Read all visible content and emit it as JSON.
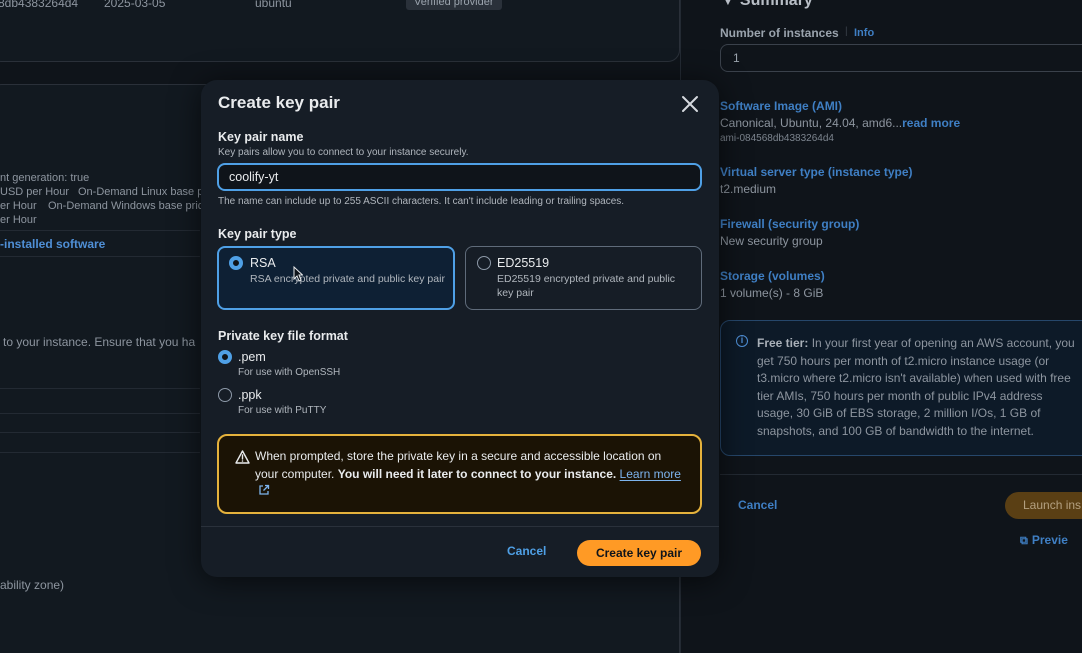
{
  "background": {
    "top_row": {
      "id": "8db4383264d4",
      "date": "2025-03-05",
      "platform": "ubuntu",
      "badge": "Verified provider"
    },
    "left_lines": [
      "nt generation: true",
      "USD per Hour",
      "On-Demand Linux base pric",
      "er Hour",
      "On-Demand Windows base pric",
      "er Hour"
    ],
    "preinstalled_link": "-installed software",
    "keypair_hint": "to your instance. Ensure that you ha",
    "availability_zone": "ability zone)",
    "summary": {
      "title": "Summary",
      "instances_label": "Number of instances",
      "info": "Info",
      "instances_value": "1",
      "ami_label": "Software Image (AMI)",
      "ami_value": "Canonical, Ubuntu, 24.04, amd6...",
      "read_more": "read more",
      "ami_id": "ami-084568db4383264d4",
      "instance_type_label": "Virtual server type (instance type)",
      "instance_type_value": "t2.medium",
      "firewall_label": "Firewall (security group)",
      "firewall_value": "New security group",
      "storage_label": "Storage (volumes)",
      "storage_value": "1 volume(s) - 8 GiB",
      "free_tier_title": "Free tier:",
      "free_tier_text": " In your first year of opening an AWS account, you get 750 hours per month of t2.micro instance usage (or t3.micro where t2.micro isn't available) when used with free tier AMIs, 750 hours per month of public IPv4 address usage, 30 GiB of EBS storage, 2 million I/Os, 1 GB of snapshots, and 100 GB of bandwidth to the internet.",
      "cancel": "Cancel",
      "launch": "Launch ins",
      "preview": "Previe"
    }
  },
  "modal": {
    "title": "Create key pair",
    "name_label": "Key pair name",
    "name_desc": "Key pairs allow you to connect to your instance securely.",
    "name_value": "coolify-yt",
    "name_constraint": "The name can include up to 255 ASCII characters. It can't include leading or trailing spaces.",
    "type_label": "Key pair type",
    "types": [
      {
        "title": "RSA",
        "desc": "RSA encrypted private and public key pair",
        "selected": true
      },
      {
        "title": "ED25519",
        "desc": "ED25519 encrypted private and public key pair",
        "selected": false
      }
    ],
    "format_label": "Private key file format",
    "formats": [
      {
        "title": ".pem",
        "desc": "For use with OpenSSH",
        "selected": true
      },
      {
        "title": ".ppk",
        "desc": "For use with PuTTY",
        "selected": false
      }
    ],
    "alert": {
      "text_plain": "When prompted, store the private key in a secure and accessible location on your computer.",
      "text_bold": "You will need it later to connect to your instance.",
      "link": "Learn more"
    },
    "cancel": "Cancel",
    "submit": "Create key pair"
  },
  "colors": {
    "accent_blue": "#4fa0e6",
    "primary_orange": "#ff9a25",
    "warning_border": "#e5b23c",
    "modal_bg": "#161d26",
    "page_bg": "#0f141a"
  }
}
